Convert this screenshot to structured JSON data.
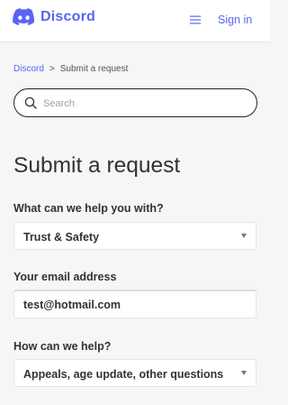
{
  "header": {
    "brand": "Discord",
    "signin_label": "Sign in",
    "menu_icon": "hamburger-icon",
    "logo_icon": "discord-logo-icon"
  },
  "breadcrumb": {
    "root": "Discord",
    "separator": ">",
    "current": "Submit a request"
  },
  "search": {
    "placeholder": "Search",
    "value": "",
    "icon": "search-icon"
  },
  "page_title": "Submit a request",
  "form": {
    "help_topic": {
      "label": "What can we help you with?",
      "selected": "Trust & Safety"
    },
    "email": {
      "label": "Your email address",
      "value": "test@hotmail.com"
    },
    "how_help": {
      "label": "How can we help?",
      "selected": "Appeals, age update, other questions"
    }
  },
  "colors": {
    "brand": "#5865f2",
    "text": "#2e3338",
    "background": "#f6f6f6"
  }
}
